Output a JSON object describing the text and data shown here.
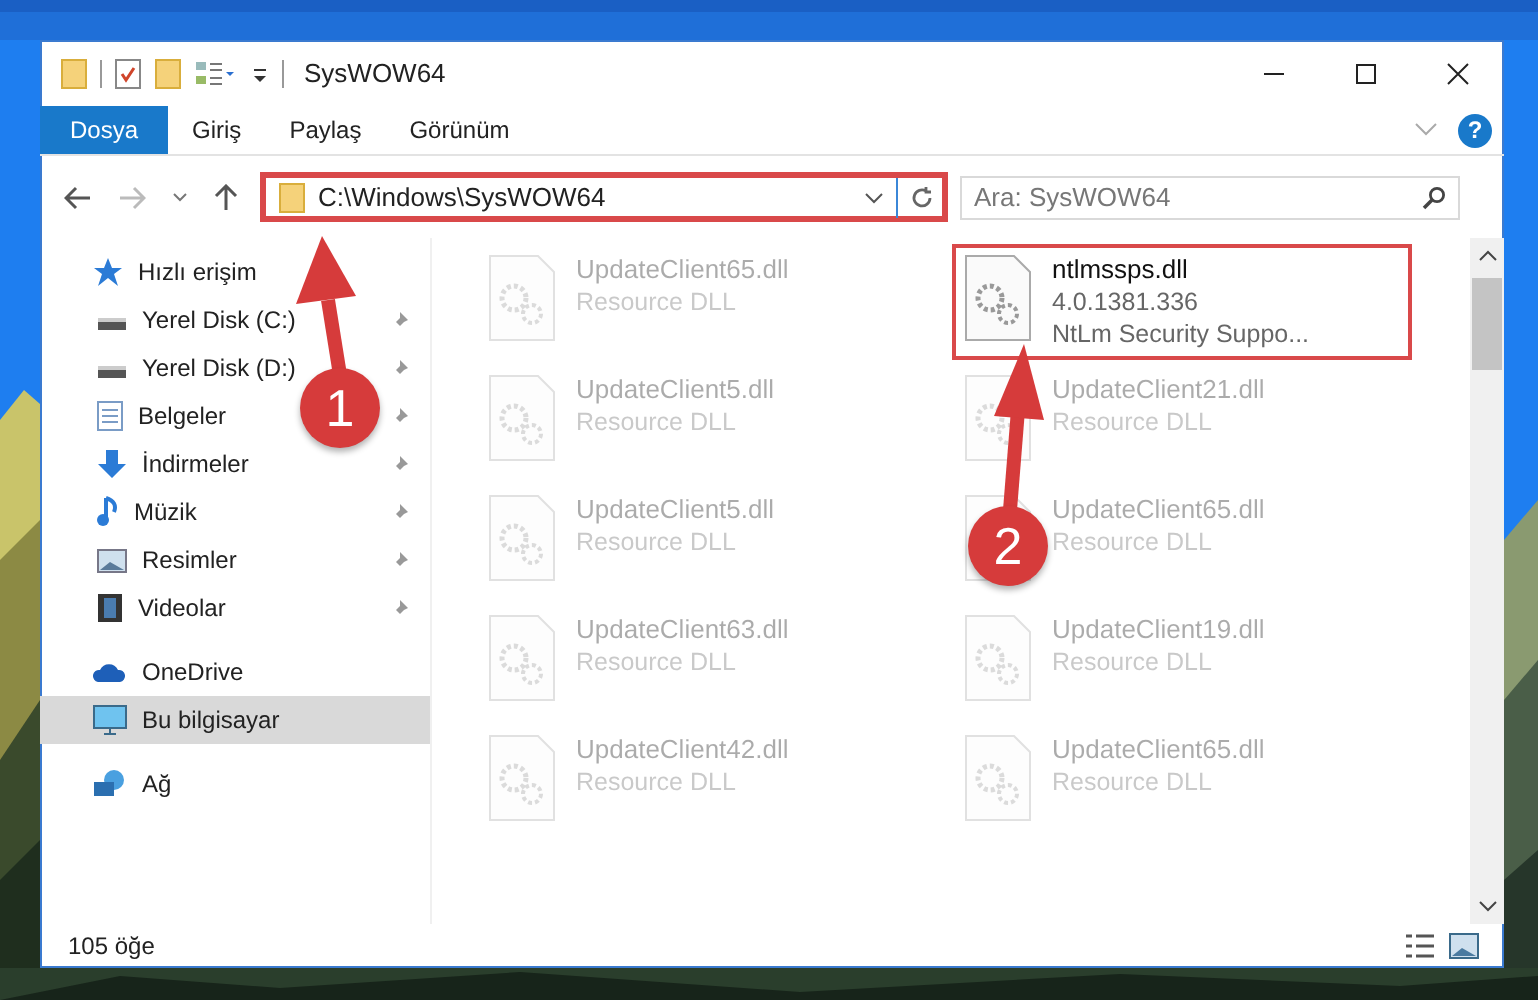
{
  "window": {
    "title": "SysWOW64"
  },
  "ribbon": {
    "tabs": [
      {
        "label": "Dosya",
        "selected": true
      },
      {
        "label": "Giriş",
        "selected": false
      },
      {
        "label": "Paylaş",
        "selected": false
      },
      {
        "label": "Görünüm",
        "selected": false
      }
    ],
    "help": "?"
  },
  "address": {
    "path": "C:\\Windows\\SysWOW64",
    "highlighted": true
  },
  "search": {
    "placeholder": "Ara: SysWOW64"
  },
  "sidebar": {
    "items": [
      {
        "label": "Hızlı erişim",
        "selected": false,
        "children": [
          {
            "label": "Yerel Disk (C:)",
            "selected": false,
            "pinned": true
          },
          {
            "label": "Yerel Disk (D:)",
            "selected": false,
            "pinned": true
          },
          {
            "label": "Belgeler",
            "selected": false,
            "pinned": true
          },
          {
            "label": "İndirmeler",
            "selected": false,
            "pinned": true
          },
          {
            "label": "Müzik",
            "selected": false,
            "pinned": true
          },
          {
            "label": "Resimler",
            "selected": false,
            "pinned": true
          },
          {
            "label": "Videolar",
            "selected": false,
            "pinned": true
          }
        ]
      },
      {
        "label": "OneDrive",
        "selected": false
      },
      {
        "label": "Bu bilgisayar",
        "selected": true
      },
      {
        "label": "Ağ",
        "selected": false
      }
    ]
  },
  "files": [
    {
      "name": "UpdateClient65.dll",
      "description": "Resource DLL",
      "highlighted": false
    },
    {
      "name": "ntlmssps.dll",
      "version": "4.0.1381.336",
      "description": "NtLm Security Suppo...",
      "highlighted": true
    },
    {
      "name": "UpdateClient5.dll",
      "description": "Resource DLL",
      "highlighted": false
    },
    {
      "name": "UpdateClient21.dll",
      "description": "Resource DLL",
      "highlighted": false
    },
    {
      "name": "UpdateClient5.dll",
      "description": "Resource DLL",
      "highlighted": false
    },
    {
      "name": "UpdateClient65.dll",
      "description": "Resource DLL",
      "highlighted": false
    },
    {
      "name": "UpdateClient63.dll",
      "description": "Resource DLL",
      "highlighted": false
    },
    {
      "name": "UpdateClient19.dll",
      "description": "Resource DLL",
      "highlighted": false
    },
    {
      "name": "UpdateClient42.dll",
      "description": "Resource DLL",
      "highlighted": false
    },
    {
      "name": "UpdateClient65.dll",
      "description": "Resource DLL",
      "highlighted": false
    }
  ],
  "status_bar": {
    "count": "105 öğe"
  },
  "annotations": [
    {
      "label": "1"
    },
    {
      "label": "2"
    }
  ]
}
